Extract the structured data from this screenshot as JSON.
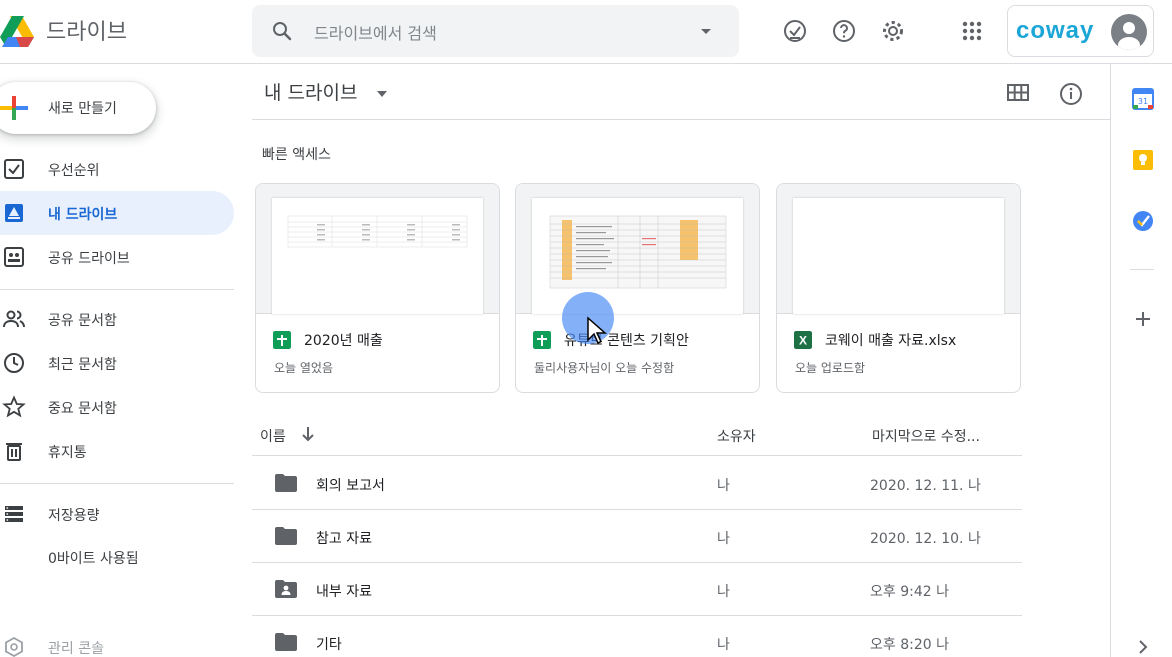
{
  "header": {
    "app_title": "드라이브",
    "search_placeholder": "드라이브에서 검색",
    "brand": "coway"
  },
  "sidebar": {
    "new_button": "새로 만들기",
    "items": [
      {
        "label": "우선순위",
        "icon": "check-box-icon"
      },
      {
        "label": "내 드라이브",
        "icon": "drive-icon",
        "active": true
      },
      {
        "label": "공유 드라이브",
        "icon": "shared-drive-icon"
      },
      {
        "label": "공유 문서함",
        "icon": "people-icon"
      },
      {
        "label": "최근 문서함",
        "icon": "clock-icon"
      },
      {
        "label": "중요 문서함",
        "icon": "star-icon"
      },
      {
        "label": "휴지통",
        "icon": "trash-icon"
      },
      {
        "label": "저장용량",
        "icon": "storage-icon"
      }
    ],
    "storage_used": "0바이트 사용됨",
    "admin_console": "관리 콘솔"
  },
  "main": {
    "title": "내 드라이브",
    "quick_access_label": "빠른 액세스",
    "quick_access": [
      {
        "name": "2020년 매출",
        "subtitle": "오늘 열었음",
        "type": "sheets"
      },
      {
        "name": "유튜브 콘텐츠 기획안",
        "subtitle": "둘리사용자님이 오늘 수정함",
        "type": "sheets"
      },
      {
        "name": "코웨이 매출 자료.xlsx",
        "subtitle": "오늘 업로드함",
        "type": "excel"
      }
    ],
    "columns": {
      "name": "이름",
      "owner": "소유자",
      "modified": "마지막으로 수정..."
    },
    "files": [
      {
        "name": "회의 보고서",
        "owner": "나",
        "modified": "2020. 12. 11. 나",
        "icon": "folder-icon"
      },
      {
        "name": "참고 자료",
        "owner": "나",
        "modified": "2020. 12. 10. 나",
        "icon": "folder-icon"
      },
      {
        "name": "내부 자료",
        "owner": "나",
        "modified": "오후 9:42 나",
        "icon": "shared-folder-icon"
      },
      {
        "name": "기타",
        "owner": "나",
        "modified": "오후 8:20 나",
        "icon": "folder-icon"
      }
    ]
  },
  "colors": {
    "accent": "#1967d2",
    "active_bg": "#e8f0fe",
    "brand": "#1ba6d7",
    "sheets": "#0f9d58",
    "excel": "#1e7145"
  }
}
